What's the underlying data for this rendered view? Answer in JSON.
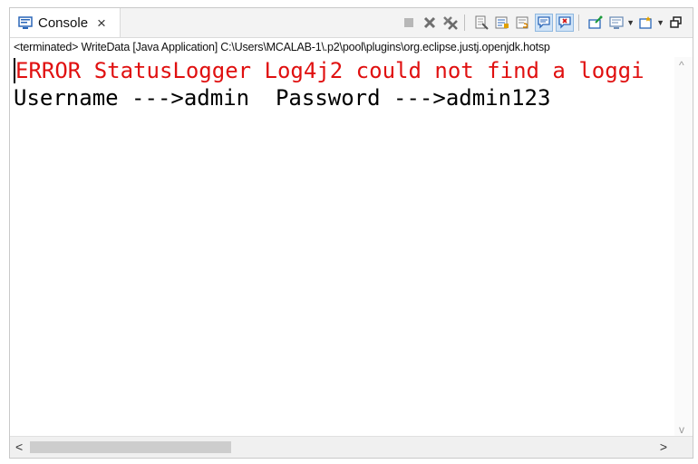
{
  "tab": {
    "label": "Console",
    "close": "×"
  },
  "status_line": "<terminated> WriteData [Java Application] C:\\Users\\MCALAB-1\\.p2\\pool\\plugins\\org.eclipse.justj.openjdk.hotsp",
  "console": {
    "lines": [
      {
        "type": "error",
        "text": "ERROR StatusLogger Log4j2 could not find a loggi"
      },
      {
        "type": "out",
        "text": "Username --->admin  Password --->admin123"
      }
    ]
  },
  "scroll": {
    "up": "^",
    "down": "v",
    "left": "<",
    "right": ">"
  },
  "colors": {
    "error": "#e01010",
    "accent": "#2a66b8"
  },
  "toolbar_icons": [
    "terminate-icon",
    "remove-launch-icon",
    "remove-all-terminated-icon",
    "clear-console-icon",
    "scroll-lock-icon",
    "word-wrap-icon",
    "show-on-stdout-icon",
    "show-on-stderr-icon",
    "pin-console-icon",
    "display-selected-console-icon",
    "open-console-icon",
    "minimize-icon"
  ]
}
